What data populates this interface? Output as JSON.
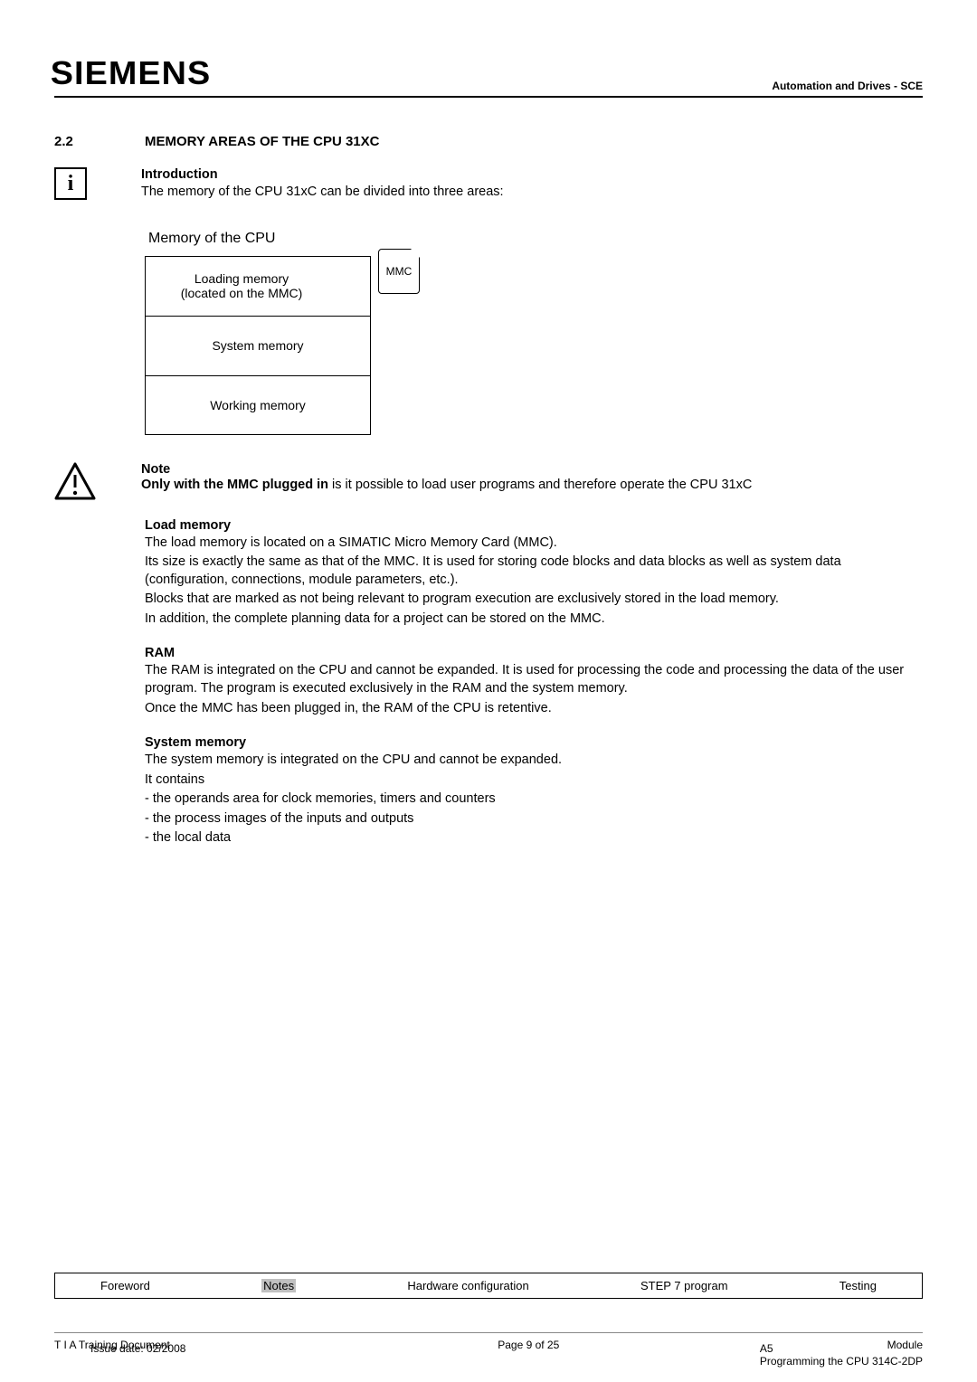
{
  "header": {
    "logo": "SIEMENS",
    "right": "Automation and Drives - SCE"
  },
  "section": {
    "num": "2.2",
    "title": "MEMORY AREAS OF THE CPU 31XC"
  },
  "intro": {
    "heading": "Introduction",
    "text": "The memory of the CPU 31xC can be divided into three areas:"
  },
  "diagram": {
    "title": "Memory of the CPU",
    "box1_line1": "Loading memory",
    "box1_line2": "(located on the MMC)",
    "box2": "System memory",
    "box3": "Working memory",
    "chip": "MMC"
  },
  "note": {
    "heading": "Note",
    "bold": "Only with the MMC plugged in",
    "rest": " is it possible to load user programs and therefore operate the CPU 31xC"
  },
  "load": {
    "heading": "Load memory",
    "p1": "The load memory is located on a SIMATIC Micro Memory Card (MMC).",
    "p2": "Its size is exactly the same as that of the MMC. It is used for storing code blocks and data blocks as well as system data (configuration, connections, module parameters, etc.).",
    "p3": "Blocks that are marked as not being relevant to program execution are exclusively stored in the load memory.",
    "p4": "In addition, the complete planning data for a project can be stored on the MMC."
  },
  "ram": {
    "heading": "RAM",
    "p1": "The RAM is integrated on the CPU and cannot be expanded. It is used for processing the code and processing the data of the user program. The program is executed exclusively in the RAM and the system memory.",
    "p2": "Once the MMC has been plugged in, the RAM of the CPU is retentive."
  },
  "sys": {
    "heading": "System memory",
    "p1": "The system memory is integrated on the CPU and cannot be expanded.",
    "p2": "It contains",
    "li1": "- the operands area for clock memories, timers and counters",
    "li2": "- the process images of the inputs and outputs",
    "li3": "- the local data"
  },
  "nav": {
    "foreword": "Foreword",
    "notes": "Notes",
    "hw": "Hardware configuration",
    "step7": "STEP 7 program",
    "testing": "Testing"
  },
  "footer": {
    "left1": "T I A  Training Document",
    "center": "Page 9 of 25",
    "right1": "Module",
    "left2": "Issue date: 02/2008",
    "right2a": "A5",
    "right2b": "Programming the CPU 314C-2DP"
  }
}
